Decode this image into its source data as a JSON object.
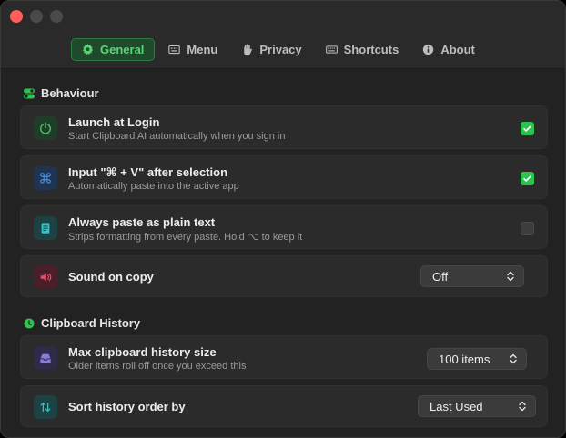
{
  "tabs": [
    {
      "label": "General",
      "icon": "gear-icon",
      "active": true
    },
    {
      "label": "Menu",
      "icon": "keyboard-menu-icon",
      "active": false
    },
    {
      "label": "Privacy",
      "icon": "hand-icon",
      "active": false
    },
    {
      "label": "Shortcuts",
      "icon": "keyboard-icon",
      "active": false
    },
    {
      "label": "About",
      "icon": "info-icon",
      "active": false
    }
  ],
  "behaviour": {
    "title": "Behaviour",
    "rows": [
      {
        "title": "Launch at Login",
        "subtitle": "Start Clipboard AI automatically when you sign in",
        "checked": true,
        "icon": "power-icon",
        "color": "#4cc46a"
      },
      {
        "title": "Input \"⌘ + V\" after selection",
        "subtitle": "Automatically paste into the active app",
        "checked": true,
        "icon": "command-icon",
        "color": "#4a8fe0"
      },
      {
        "title": "Always paste as plain text",
        "subtitle": "Strips formatting from every paste. Hold ⌥ to keep it",
        "checked": false,
        "icon": "document-icon",
        "color": "#3cc0c4"
      },
      {
        "title": "Sound on copy",
        "select_value": "Off",
        "icon": "speaker-icon",
        "color": "#e0506a"
      }
    ]
  },
  "history": {
    "title": "Clipboard History",
    "rows": [
      {
        "title": "Max clipboard history size",
        "subtitle": "Older items roll off once you exceed this",
        "select_value": "100 items",
        "icon": "tray-icon",
        "color": "#8a7ad8"
      },
      {
        "title": "Sort history order by",
        "select_value": "Last Used",
        "icon": "sort-arrows-icon",
        "color": "#3cc0c4"
      }
    ]
  },
  "colors": {
    "accent": "#30c251",
    "window": "#222222",
    "row": "#2b2b2b"
  }
}
